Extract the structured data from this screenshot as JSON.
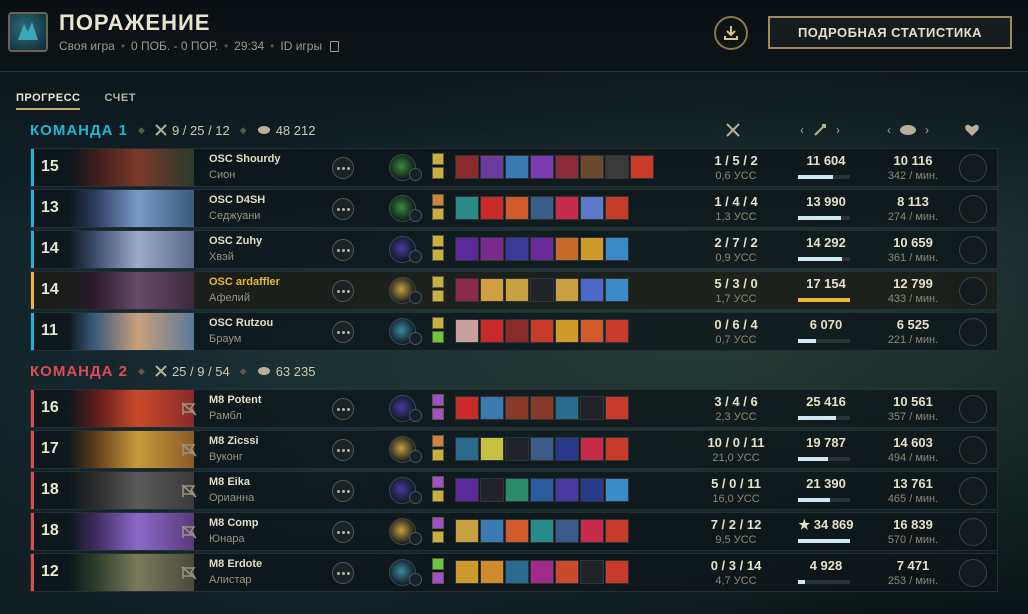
{
  "header": {
    "title": "ПОРАЖЕНИЕ",
    "mode": "Своя игра",
    "record": "0 ПОБ. - 0 ПОР.",
    "duration": "29:34",
    "game_id_label": "ID игры",
    "download_icon": "download-icon",
    "stats_button": "ПОДРОБНАЯ СТАТИСТИКА"
  },
  "tabs": [
    "ПРОГРЕСС",
    "СЧЕТ"
  ],
  "active_tab": "ПРОГРЕСС",
  "columns": {
    "kda_icon": "crossed-swords-icon",
    "damage_icon": "sword-icon",
    "gold_icon": "gold-icon",
    "honor_icon": "heart-icon",
    "prev": "‹",
    "next": "›"
  },
  "teams": [
    {
      "name": "КОМАНДА 1",
      "kda": "9 / 25 / 12",
      "gold": "48 212",
      "color": "#1fb6d6",
      "players": [
        {
          "level": "15",
          "name": "OSC Shourdy",
          "champion": "Сион",
          "kda": "1 / 5 / 2",
          "kda_sub": "0,6 УСС",
          "damage": "11 604",
          "damage_ratio": 0.68,
          "gold": "10 116",
          "gold_sub": "342 / мин.",
          "portrait": [
            "#3a1c1c",
            "#7a3a2a",
            "#2a3a2a"
          ],
          "rune": "#3c8a3a",
          "spells": [
            "#c8b040",
            "#c8b040"
          ],
          "items": [
            "#8a2a2a",
            "#6a3aa0",
            "#3a7ab0",
            "#7a3ab0",
            "#8a2a3a",
            "#6a4a2a",
            "#3a3a3a",
            "#c83a2a"
          ]
        },
        {
          "level": "13",
          "name": "OSC D4SH",
          "champion": "Седжуани",
          "kda": "1 / 4 / 4",
          "kda_sub": "1,3 УСС",
          "damage": "13 990",
          "damage_ratio": 0.82,
          "gold": "8 113",
          "gold_sub": "274 / мин.",
          "portrait": [
            "#2a3a5a",
            "#7a9ac8",
            "#3a5a7a"
          ],
          "rune": "#3c8a3a",
          "spells": [
            "#d08040",
            "#c8b040"
          ],
          "items": [
            "#2a8a8a",
            "#c82a2a",
            "#d05a2a",
            "#3a5a8a",
            "#c82a4a",
            "#5a7ac8",
            "#c83a2a"
          ]
        },
        {
          "level": "14",
          "name": "OSC Zuhy",
          "champion": "Хвэй",
          "kda": "2 / 7 / 2",
          "kda_sub": "0,9 УСС",
          "damage": "14 292",
          "damage_ratio": 0.84,
          "gold": "10 659",
          "gold_sub": "361 / мин.",
          "portrait": [
            "#3a4a6a",
            "#9aaac8",
            "#5a6a8a"
          ],
          "rune": "#4a3aa0",
          "spells": [
            "#c8b040",
            "#c8b040"
          ],
          "items": [
            "#5a2a9a",
            "#7a2a8a",
            "#3a3a9a",
            "#6a2a9a",
            "#c86a2a",
            "#d09a2a",
            "#3a8ac8"
          ]
        },
        {
          "level": "14",
          "name": "OSC ardaffler",
          "champion": "Афелий",
          "kda": "5 / 3 / 0",
          "kda_sub": "1,7 УСС",
          "damage": "17 154",
          "damage_ratio": 1.0,
          "gold": "12 799",
          "gold_sub": "433 / мин.",
          "portrait": [
            "#2a1a2a",
            "#6a4a6a",
            "#3a2a3a"
          ],
          "rune": "#c8a040",
          "spells": [
            "#c8b040",
            "#c8b040"
          ],
          "items": [
            "#8a2a4a",
            "#d0a040",
            "#c8a040",
            "#202428",
            "#c8a040",
            "#4a6ac8",
            "#3a8ac8"
          ],
          "me": true
        },
        {
          "level": "11",
          "name": "OSC Rutzou",
          "champion": "Браум",
          "kda": "0 / 6 / 4",
          "kda_sub": "0,7 УСС",
          "damage": "6 070",
          "damage_ratio": 0.35,
          "gold": "6 525",
          "gold_sub": "221 / мин.",
          "portrait": [
            "#3a5a7a",
            "#c8a07a",
            "#5a7a9a"
          ],
          "rune": "#3a8aa0",
          "spells": [
            "#c8b040",
            "#6ac840"
          ],
          "items": [
            "#c8a0a0",
            "#c82a2a",
            "#8a2a2a",
            "#c83a2a",
            "#d09a2a",
            "#d05a2a",
            "#c83a2a"
          ]
        }
      ]
    },
    {
      "name": "КОМАНДА 2",
      "kda": "25 / 9 / 54",
      "gold": "63 235",
      "color": "#e04a55",
      "players": [
        {
          "level": "16",
          "name": "M8 Potent",
          "champion": "Рамбл",
          "kda": "3 / 4 / 6",
          "kda_sub": "2,3 УСС",
          "damage": "25 416",
          "damage_ratio": 0.73,
          "gold": "10 561",
          "gold_sub": "357 / мин.",
          "portrait": [
            "#5a1a1a",
            "#c84a2a",
            "#8a2a2a"
          ],
          "rune": "#4a3aa0",
          "spells": [
            "#a050c8",
            "#a050c8"
          ],
          "items": [
            "#c82a2a",
            "#3a7ab0",
            "#8a3a2a",
            "#8a3a2a",
            "#2a6a8a",
            "#202428",
            "#c83a2a"
          ]
        },
        {
          "level": "17",
          "name": "M8 Zicssi",
          "champion": "Вуконг",
          "kda": "10 / 0 / 11",
          "kda_sub": "21,0 УСС",
          "damage": "19 787",
          "damage_ratio": 0.57,
          "gold": "14 603",
          "gold_sub": "494 / мин.",
          "portrait": [
            "#5a3a1a",
            "#c89a3a",
            "#8a5a2a"
          ],
          "rune": "#c8a040",
          "spells": [
            "#d08040",
            "#c8b040"
          ],
          "items": [
            "#2a6a8a",
            "#c8c040",
            "#202428",
            "#3a5a8a",
            "#2a3a8a",
            "#c82a4a",
            "#c83a2a"
          ]
        },
        {
          "level": "18",
          "name": "M8 Eika",
          "champion": "Орианна",
          "kda": "5 / 0 / 11",
          "kda_sub": "16,0 УСС",
          "damage": "21 390",
          "damage_ratio": 0.61,
          "gold": "13 761",
          "gold_sub": "465 / мин.",
          "portrait": [
            "#2a2a2a",
            "#5a5a5a",
            "#3a3a3a"
          ],
          "rune": "#4a3aa0",
          "spells": [
            "#a050c8",
            "#c8b040"
          ],
          "items": [
            "#5a2a9a",
            "#202428",
            "#2a8a6a",
            "#2a5aa0",
            "#4a3aa0",
            "#2a3a8a",
            "#3a8ac8"
          ]
        },
        {
          "level": "18",
          "name": "M8 Comp",
          "champion": "Юнара",
          "kda": "7 / 2 / 12",
          "kda_sub": "9,5 УСС",
          "damage": "★ 34 869",
          "damage_ratio": 1.0,
          "gold": "16 839",
          "gold_sub": "570 / мин.",
          "portrait": [
            "#3a2a5a",
            "#8a6ac8",
            "#5a3a7a"
          ],
          "rune": "#c8a040",
          "spells": [
            "#a050c8",
            "#c8b040"
          ],
          "items": [
            "#c8a040",
            "#3a7ab0",
            "#d05a2a",
            "#2a8a8a",
            "#3a5a8a",
            "#c82a4a",
            "#c83a2a"
          ]
        },
        {
          "level": "12",
          "name": "M8 Erdote",
          "champion": "Алистар",
          "kda": "0 / 3 / 14",
          "kda_sub": "4,7 УСС",
          "damage": "4 928",
          "damage_ratio": 0.14,
          "gold": "7 471",
          "gold_sub": "253 / мин.",
          "portrait": [
            "#2a3a2a",
            "#7a7a5a",
            "#4a4a3a"
          ],
          "rune": "#3a8aa0",
          "spells": [
            "#6ac840",
            "#a050c8"
          ],
          "items": [
            "#d09a2a",
            "#d08a2a",
            "#2a6a8a",
            "#a02a8a",
            "#c84a2a",
            "#202428",
            "#c83a2a"
          ]
        }
      ]
    }
  ]
}
